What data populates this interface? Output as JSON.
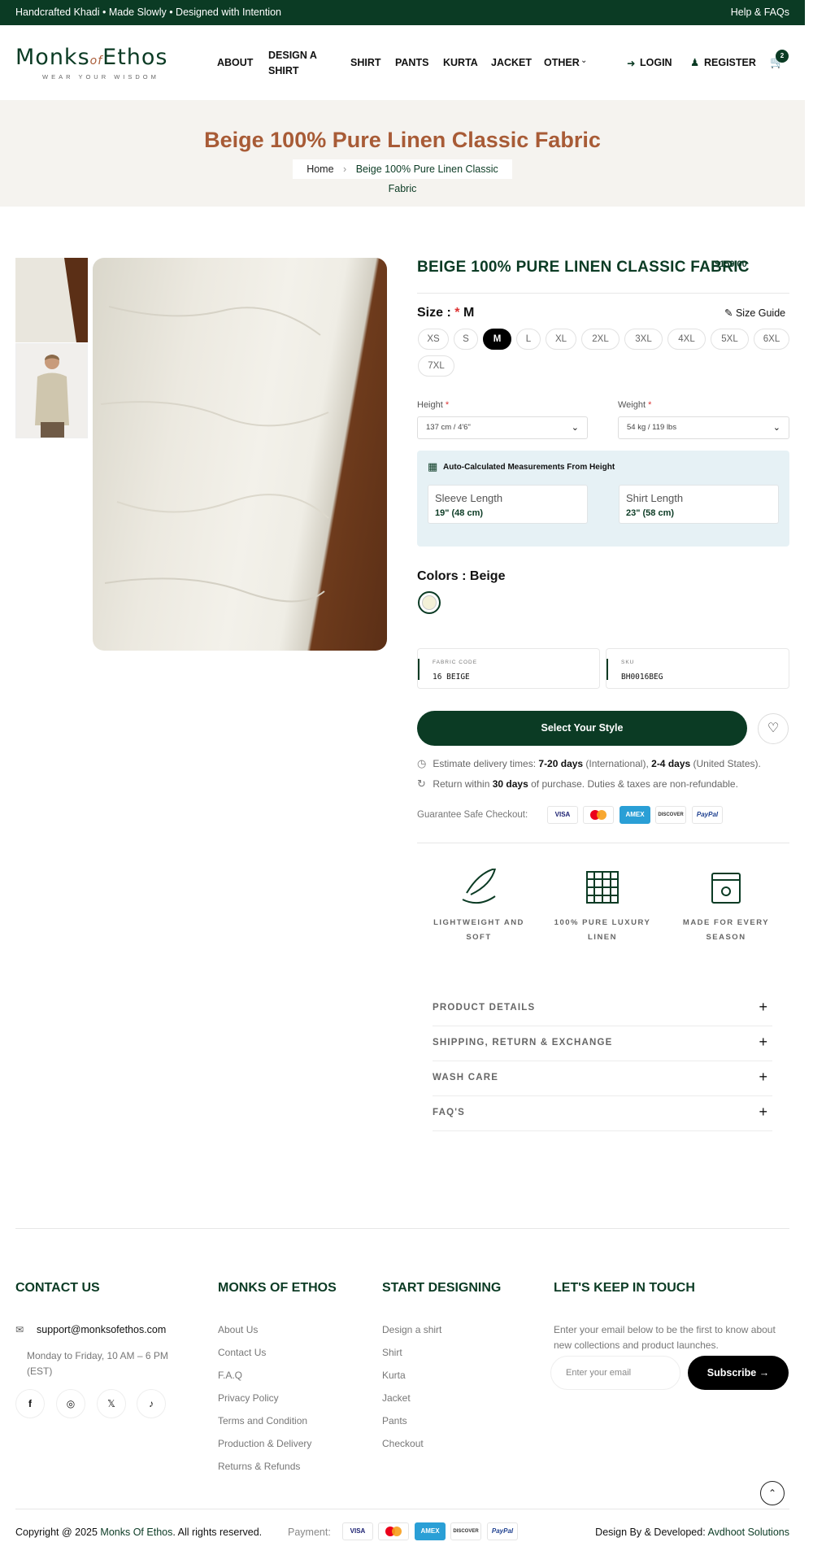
{
  "topbar": {
    "left": "Handcrafted Khadi  •  Made Slowly  •  Designed with Intention",
    "right": "Help & FAQs"
  },
  "logo": {
    "name_a": "Monks",
    "name_of": "of",
    "name_b": "Ethos",
    "tagline": "WEAR YOUR WISDOM"
  },
  "nav": {
    "about": "ABOUT",
    "design_1": "DESIGN A",
    "design_2": "SHIRT",
    "shirt": "SHIRT",
    "pants": "PANTS",
    "kurta": "KURTA",
    "jacket": "JACKET",
    "other": "OTHER",
    "login": "LOGIN",
    "register": "REGISTER",
    "cart_count": "2"
  },
  "hero": {
    "title": "Beige 100% Pure Linen Classic Fabric",
    "crumb_home": "Home",
    "crumb_current": "Beige 100% Pure Linen Classic Fabric"
  },
  "product": {
    "title": "BEIGE 100% PURE LINEN CLASSIC FABRIC",
    "price": "$159.00",
    "size_label": "Size :",
    "size_star": "*",
    "size_value": "M",
    "size_guide": "Size Guide",
    "sizes": [
      "XS",
      "S",
      "M",
      "L",
      "XL",
      "2XL",
      "3XL",
      "4XL",
      "5XL",
      "6XL",
      "7XL"
    ],
    "selected_size": "M",
    "height_label": "Height",
    "height_value": "137 cm / 4'6\"",
    "weight_label": "Weight",
    "weight_value": "54 kg / 119 lbs",
    "required_star": "*",
    "calc_heading": "Auto-Calculated Measurements From Height",
    "sleeve_label": "Sleeve Length",
    "sleeve_value": "19\" (48 cm)",
    "shirt_label": "Shirt Length",
    "shirt_value": "23\" (58 cm)",
    "colors_label": "Colors : Beige",
    "fabric_code_label": "FABRIC CODE",
    "fabric_code": "16 BEIGE",
    "sku_label": "SKU",
    "sku": "BH0016BEG",
    "cta": "Select Your Style",
    "delivery_pre": "Estimate delivery times: ",
    "delivery_intl": "7-20 days",
    "delivery_mid": " (International), ",
    "delivery_us": "2-4 days",
    "delivery_post": " (United States).",
    "return_pre": "Return within ",
    "return_days": "30 days",
    "return_post": " of purchase. Duties & taxes are non-refundable.",
    "guarantee": "Guarantee Safe Checkout:",
    "payments": [
      "VISA",
      "MC",
      "AMEX",
      "DISCOVER",
      "PayPal"
    ]
  },
  "features": [
    {
      "line1": "LIGHTWEIGHT AND",
      "line2": "SOFT"
    },
    {
      "line1": "100% PURE LUXURY",
      "line2": "LINEN"
    },
    {
      "line1": "MADE FOR EVERY",
      "line2": "SEASON"
    }
  ],
  "accordion": [
    "PRODUCT DETAILS",
    "SHIPPING, RETURN & EXCHANGE",
    "WASH CARE",
    "FAQ'S"
  ],
  "footer": {
    "contact_head": "CONTACT US",
    "email": "support@monksofethos.com",
    "hours_1": "Monday to Friday, 10 AM – 6 PM",
    "hours_2": "(EST)",
    "social": [
      "f",
      "◎",
      "𝕏",
      "♪"
    ],
    "monks_head": "MONKS OF ETHOS",
    "monks_links": [
      "About Us",
      "Contact Us",
      "F.A.Q",
      "Privacy Policy",
      "Terms and Condition",
      "Production & Delivery",
      "Returns & Refunds"
    ],
    "design_head": "START DESIGNING",
    "design_links": [
      "Design a shirt",
      "Shirt",
      "Kurta",
      "Jacket",
      "Pants",
      "Checkout"
    ],
    "touch_head": "LET'S KEEP IN TOUCH",
    "touch_1": "Enter your email below to be the first to know about",
    "touch_2": "new collections and product launches.",
    "email_placeholder": "Enter your email",
    "subscribe": "Subscribe",
    "copyright_pre": "Copyright @ 2025 ",
    "copyright_brand": "Monks Of Ethos",
    "copyright_post": ". All rights reserved.",
    "payment_label": "Payment:",
    "credit_pre": "Design By & Developed: ",
    "credit_name": "Avdhoot Solutions"
  },
  "colors": {
    "brand_green": "#0b3b24",
    "accent_rust": "#a85b36"
  }
}
